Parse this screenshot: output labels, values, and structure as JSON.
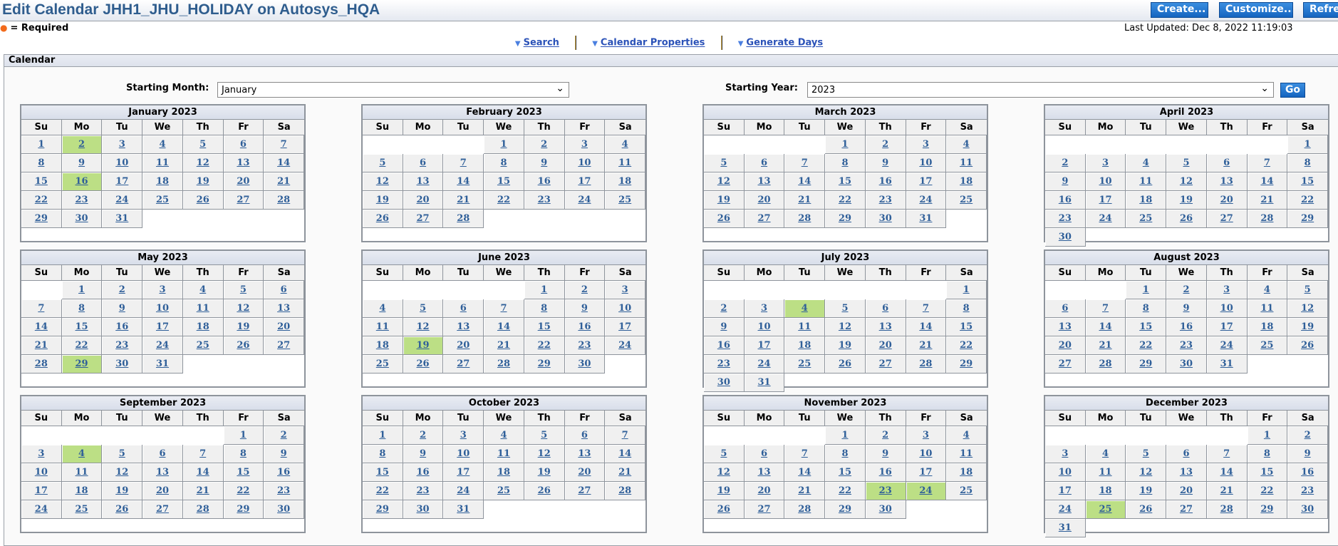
{
  "header": {
    "title": "Edit Calendar JHH1_JHU_HOLIDAY on Autosys_HQA",
    "buttons": [
      "Create...",
      "Customize...",
      "Refresh"
    ]
  },
  "required_label": "= Required",
  "last_updated": "Last Updated: Dec 8, 2022 11:19:03",
  "nav": [
    "Search",
    "Calendar Properties",
    "Generate Days"
  ],
  "section_title": "Calendar",
  "starting_month": {
    "label": "Starting Month:",
    "value": "January"
  },
  "starting_year": {
    "label": "Starting Year:",
    "value": "2023"
  },
  "go_label": "Go",
  "day_names": [
    "Su",
    "Mo",
    "Tu",
    "We",
    "Th",
    "Fr",
    "Sa"
  ],
  "colors": {
    "highlight": "#bcdf85",
    "link": "#2f5f99",
    "button": "#1e74d0"
  },
  "months": [
    {
      "title": "January 2023",
      "first_weekday": 0,
      "days": 31,
      "selected": [
        2,
        16
      ]
    },
    {
      "title": "February 2023",
      "first_weekday": 3,
      "days": 28,
      "selected": []
    },
    {
      "title": "March 2023",
      "first_weekday": 3,
      "days": 31,
      "selected": []
    },
    {
      "title": "April 2023",
      "first_weekday": 6,
      "days": 30,
      "selected": []
    },
    {
      "title": "May 2023",
      "first_weekday": 1,
      "days": 31,
      "selected": [
        29
      ]
    },
    {
      "title": "June 2023",
      "first_weekday": 4,
      "days": 30,
      "selected": [
        19
      ]
    },
    {
      "title": "July 2023",
      "first_weekday": 6,
      "days": 31,
      "selected": [
        4
      ]
    },
    {
      "title": "August 2023",
      "first_weekday": 2,
      "days": 31,
      "selected": []
    },
    {
      "title": "September 2023",
      "first_weekday": 5,
      "days": 30,
      "selected": [
        4
      ]
    },
    {
      "title": "October 2023",
      "first_weekday": 0,
      "days": 31,
      "selected": []
    },
    {
      "title": "November 2023",
      "first_weekday": 3,
      "days": 30,
      "selected": [
        23,
        24
      ]
    },
    {
      "title": "December 2023",
      "first_weekday": 5,
      "days": 31,
      "selected": [
        25
      ]
    }
  ]
}
